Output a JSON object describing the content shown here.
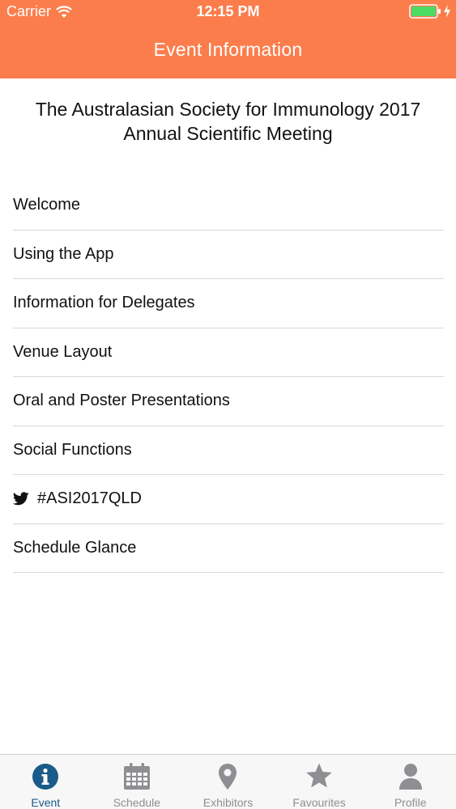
{
  "status_bar": {
    "carrier": "Carrier",
    "time": "12:15 PM",
    "icons": [
      "wifi-icon",
      "battery-icon",
      "charging-bolt-icon"
    ]
  },
  "nav": {
    "title": "Event Information"
  },
  "event": {
    "title_line1": "The Australasian Society for Immunology 2017",
    "title_line2": "Annual Scientific Meeting"
  },
  "menu": {
    "items": [
      {
        "label": "Welcome"
      },
      {
        "label": "Using the App"
      },
      {
        "label": "Information for Delegates"
      },
      {
        "label": "Venue Layout"
      },
      {
        "label": "Oral and Poster Presentations"
      },
      {
        "label": "Social Functions"
      },
      {
        "label": "#ASI2017QLD",
        "icon": "twitter-icon"
      },
      {
        "label": "Schedule Glance"
      }
    ]
  },
  "tab_bar": {
    "tabs": [
      {
        "label": "Event",
        "icon": "info-icon",
        "active": true
      },
      {
        "label": "Schedule",
        "icon": "calendar-icon",
        "active": false
      },
      {
        "label": "Exhibitors",
        "icon": "map-pin-icon",
        "active": false
      },
      {
        "label": "Favourites",
        "icon": "star-icon",
        "active": false
      },
      {
        "label": "Profile",
        "icon": "person-icon",
        "active": false
      }
    ]
  },
  "colors": {
    "header": "#FB7D4C",
    "tab_active": "#1A5B8A",
    "tab_inactive": "#8e8e93",
    "battery_fill": "#4CD964"
  }
}
